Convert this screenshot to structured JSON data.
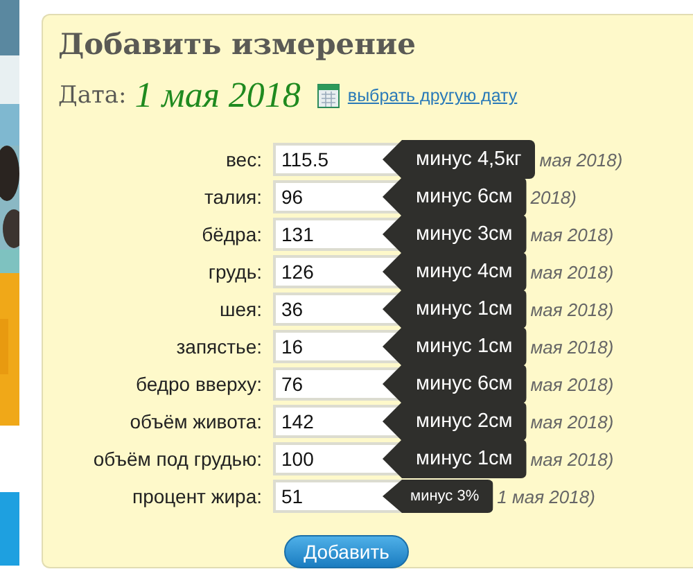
{
  "panel": {
    "title": "Добавить измерение",
    "date_label": "Дата:",
    "date": "1 мая 2018",
    "date_link": "выбрать другую дату"
  },
  "fields": [
    {
      "label": "вес:",
      "value": "115.5",
      "hint": "мая 2018)",
      "change": "минус 4,5кг"
    },
    {
      "label": "талия:",
      "value": "96",
      "hint": "2018)",
      "change": "минус 6см"
    },
    {
      "label": "бёдра:",
      "value": "131",
      "hint": "мая 2018)",
      "change": "минус 3см"
    },
    {
      "label": "грудь:",
      "value": "126",
      "hint": "мая 2018)",
      "change": "минус 4см"
    },
    {
      "label": "шея:",
      "value": "36",
      "hint": "мая 2018)",
      "change": "минус 1см"
    },
    {
      "label": "запястье:",
      "value": "16",
      "hint": "мая 2018)",
      "change": "минус 1см"
    },
    {
      "label": "бедро вверху:",
      "value": "76",
      "hint": "мая 2018)",
      "change": "минус 6см"
    },
    {
      "label": "объём живота:",
      "value": "142",
      "hint": "мая 2018)",
      "change": "минус 2см"
    },
    {
      "label": "объём под грудью:",
      "value": "100",
      "hint": "мая 2018)",
      "change": "минус 1см"
    },
    {
      "label": "процент жира:",
      "value": "51",
      "hint": "1 мая 2018)",
      "change": "минус 3%"
    }
  ],
  "submit": "Добавить"
}
